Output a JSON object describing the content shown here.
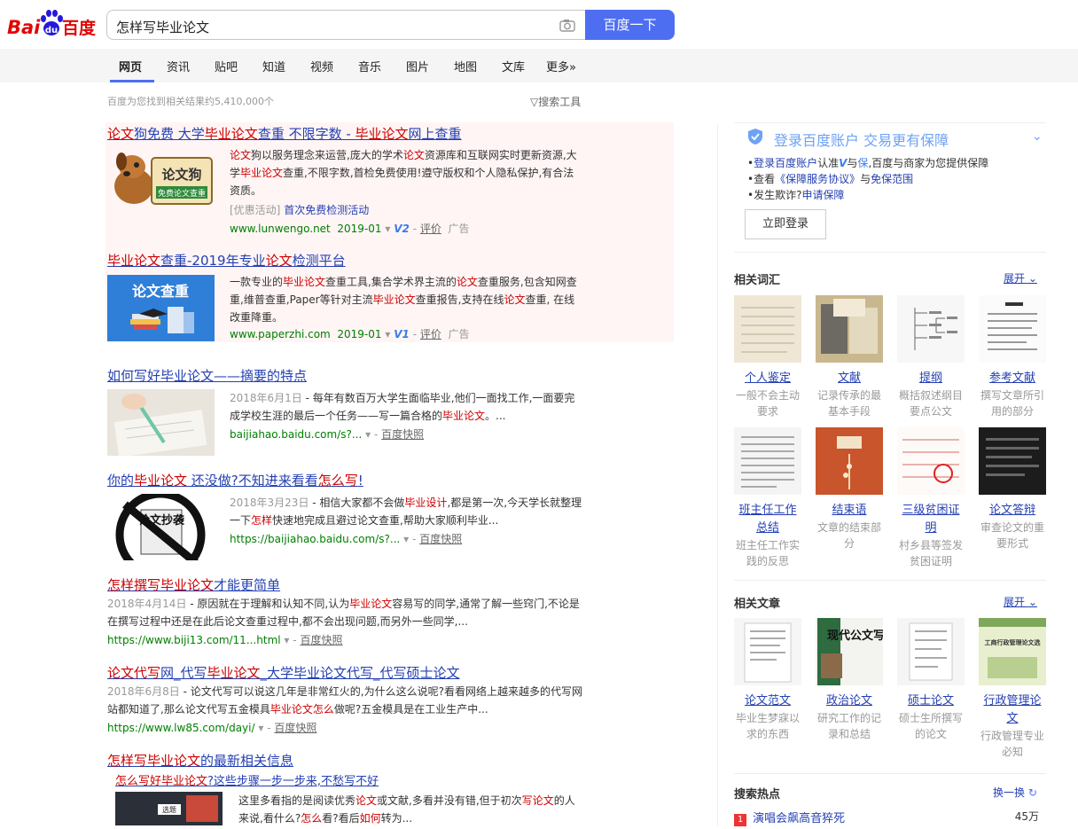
{
  "header": {
    "logo_text_left": "Bai",
    "logo_text_mid": "du",
    "logo_text_right": "百度",
    "search_value": "怎样写毕业论文",
    "search_button": "百度一下"
  },
  "nav": {
    "tabs": [
      "网页",
      "资讯",
      "贴吧",
      "知道",
      "视频",
      "音乐",
      "图片",
      "地图",
      "文库",
      "更多»"
    ]
  },
  "result_count": "百度为您找到相关结果约5,410,000个",
  "search_tools": "搜索工具",
  "results": [
    {
      "title_parts": [
        "论文",
        "狗免费 大学",
        "毕业论文",
        "查重 不限字数 - ",
        "毕业论文",
        "网上查重"
      ],
      "desc_parts": [
        "论文",
        "狗以服务理念来运营,庞大的学术",
        "论文",
        "资源库和互联网实时更新资源,大学",
        "毕业论文",
        "查重,不限字数,首检免费使用!遵守版权和个人隐私保护,有合法资质。"
      ],
      "promo_prefix": "[优惠活动]",
      "promo_link": "首次免费检测活动",
      "url": "www.lunwengo.net",
      "date": "2019-01",
      "v_badge": "V2",
      "review": "评价",
      "ad": "广告",
      "thumb_text_1": "论文狗",
      "thumb_text_2": "免费论文查重"
    },
    {
      "title_parts": [
        "毕业论文",
        "查重-2019年专业",
        "论文",
        "检测平台"
      ],
      "desc_parts": [
        "一款专业的",
        "毕业论文",
        "查重工具,集合学术界主流的",
        "论文",
        "查重服务,包含知网查重,维普查重,Paper等针对主流",
        "毕业论文",
        "查重报告,支持在线",
        "论文",
        "查重, 在线改重降重。"
      ],
      "url": "www.paperzhi.com",
      "date": "2019-01",
      "v_badge": "V1",
      "review": "评价",
      "ad": "广告",
      "thumb_text": "论文查重"
    },
    {
      "title": "如何写好毕业论文——摘要的特点",
      "date": "2018年6月1日",
      "desc_parts": [
        " - 每年有数百万大学生面临毕业,他们一面找工作,一面要完成学校生涯的最后一个任务——写一篇合格的",
        "毕业论文",
        "。..."
      ],
      "url": "baijiahao.baidu.com/s?...",
      "snapshot": "百度快照"
    },
    {
      "title_parts": [
        "你的",
        "毕业论文",
        " 还没做?不知进来看看",
        "怎么写",
        "!"
      ],
      "date": "2018年3月23日",
      "desc_parts": [
        " - 相信大家都不会做",
        "毕业设计",
        ",都是第一次,今天学长就整理一下",
        "怎样",
        "快速地完成且避过论文查重,帮助大家顺利毕业..."
      ],
      "url": "https://baijiahao.baidu.com/s?...",
      "snapshot": "百度快照",
      "thumb_text": "论文抄袭"
    },
    {
      "title_parts": [
        "怎样撰写",
        "毕业论文",
        "才能更简单"
      ],
      "date": "2018年4月14日",
      "desc_parts": [
        " - 原因就在于理解和认知不同,认为",
        "毕业论文",
        "容易写的同学,通常了解一些窍门,不论是在撰写过程中还是在此后论文查重过程中,都不会出现问题,而另外一些同学,..."
      ],
      "url": "https://www.biji13.com/11...html",
      "snapshot": "百度快照"
    },
    {
      "title_parts": [
        "论文代写",
        "网_代写",
        "毕业论文",
        "_大学毕业论文代写_代写硕士论文"
      ],
      "date": "2018年6月8日",
      "desc_parts": [
        " - 论文代写可以说这几年是非常红火的,为什么这么说呢?看看网络上越来越多的代写网站都知道了,那么论文代写五金模具",
        "毕业论文",
        "怎么",
        "做呢?五金模具是在工业生产中..."
      ],
      "url": "https://www.lw85.com/dayi/",
      "snapshot": "百度快照"
    },
    {
      "title_parts": [
        "怎样写毕业论文",
        "的最新相关信息"
      ],
      "sub_parts": [
        "怎么写好",
        "毕业论文",
        "?这些步骤一步一步来,不愁写不好"
      ],
      "desc_parts": [
        "这里多看指的是阅读优秀",
        "论文",
        "或文献,多看并没有错,但于初次",
        "写论文",
        "的人来说,看什么?",
        "怎么",
        "看?看后",
        "如何",
        "转为..."
      ],
      "thumb_text": "选题"
    }
  ],
  "sidebar": {
    "login": {
      "title": "登录百度账户 交易更有保障",
      "line1_link": "登录百度账户",
      "line1_rest": "认准",
      "line1_v": "V",
      "line1_and": "与",
      "line1_bao": "保",
      "line1_tail": ",百度与商家为您提供保障",
      "line2_pre": "查看",
      "line2_link1": "《保障服务协议》",
      "line2_mid": "与",
      "line2_link2": "免保范围",
      "line3_pre": "发生欺诈?",
      "line3_link": "申请保障",
      "button": "立即登录"
    },
    "related_words": {
      "heading": "相关词汇",
      "more": "展开",
      "items": [
        {
          "title": "个人鉴定",
          "desc": "一般不会主动要求"
        },
        {
          "title": "文献",
          "desc": "记录传承的最基本手段"
        },
        {
          "title": "提纲",
          "desc": "概括叙述纲目要点公文"
        },
        {
          "title": "参考文献",
          "desc": "撰写文章所引用的部分"
        },
        {
          "title": "班主任工作总结",
          "desc": "班主任工作实践的反思"
        },
        {
          "title": "结束语",
          "desc": "文章的结束部分"
        },
        {
          "title": "三级贫困证明",
          "desc": "村乡县等签发贫困证明"
        },
        {
          "title": "论文答辩",
          "desc": "审查论文的重要形式"
        }
      ]
    },
    "related_articles": {
      "heading": "相关文章",
      "more": "展开",
      "items": [
        {
          "title": "论文范文",
          "desc": "毕业生梦寐以求的东西"
        },
        {
          "title": "政治论文",
          "desc": "研究工作的记录和总结"
        },
        {
          "title": "硕士论文",
          "desc": "硕士生所撰写的论文"
        },
        {
          "title": "行政管理论文",
          "desc": "行政管理专业必知"
        }
      ],
      "cover_text_2": "现代公文写作",
      "cover_text_4": "工商行政管理论文选"
    },
    "hot": {
      "heading": "搜索热点",
      "refresh": "换一换",
      "items": [
        {
          "rank": "1",
          "title": "演唱会飙高音猝死",
          "count": "45万"
        }
      ]
    }
  },
  "colors": {
    "brand_blue": "#4e6ef2",
    "logo_red": "#e10602",
    "logo_blue": "#2319dc",
    "link_blue": "#2440b3",
    "highlight_red": "#cc0000",
    "url_green": "#008000"
  }
}
